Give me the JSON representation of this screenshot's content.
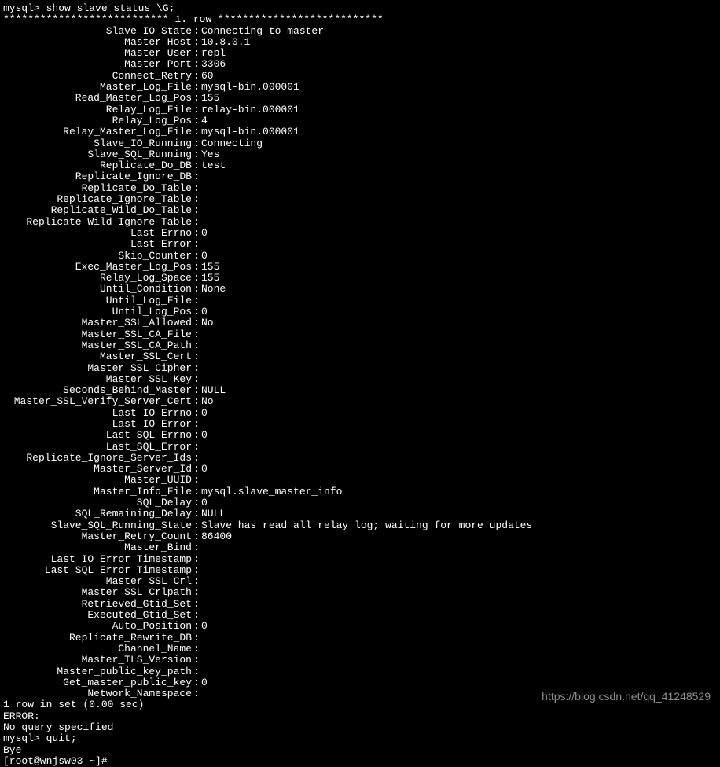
{
  "prompt1": "mysql> show slave status \\G;",
  "row_header": "*************************** 1. row ***************************",
  "status": [
    {
      "k": "Slave_IO_State",
      "v": "Connecting to master"
    },
    {
      "k": "Master_Host",
      "v": "10.8.0.1"
    },
    {
      "k": "Master_User",
      "v": "repl"
    },
    {
      "k": "Master_Port",
      "v": "3306"
    },
    {
      "k": "Connect_Retry",
      "v": "60"
    },
    {
      "k": "Master_Log_File",
      "v": "mysql-bin.000001"
    },
    {
      "k": "Read_Master_Log_Pos",
      "v": "155"
    },
    {
      "k": "Relay_Log_File",
      "v": "relay-bin.000001"
    },
    {
      "k": "Relay_Log_Pos",
      "v": "4"
    },
    {
      "k": "Relay_Master_Log_File",
      "v": "mysql-bin.000001"
    },
    {
      "k": "Slave_IO_Running",
      "v": "Connecting"
    },
    {
      "k": "Slave_SQL_Running",
      "v": "Yes"
    },
    {
      "k": "Replicate_Do_DB",
      "v": "test"
    },
    {
      "k": "Replicate_Ignore_DB",
      "v": ""
    },
    {
      "k": "Replicate_Do_Table",
      "v": ""
    },
    {
      "k": "Replicate_Ignore_Table",
      "v": ""
    },
    {
      "k": "Replicate_Wild_Do_Table",
      "v": ""
    },
    {
      "k": "Replicate_Wild_Ignore_Table",
      "v": ""
    },
    {
      "k": "Last_Errno",
      "v": "0"
    },
    {
      "k": "Last_Error",
      "v": ""
    },
    {
      "k": "Skip_Counter",
      "v": "0"
    },
    {
      "k": "Exec_Master_Log_Pos",
      "v": "155"
    },
    {
      "k": "Relay_Log_Space",
      "v": "155"
    },
    {
      "k": "Until_Condition",
      "v": "None"
    },
    {
      "k": "Until_Log_File",
      "v": ""
    },
    {
      "k": "Until_Log_Pos",
      "v": "0"
    },
    {
      "k": "Master_SSL_Allowed",
      "v": "No"
    },
    {
      "k": "Master_SSL_CA_File",
      "v": ""
    },
    {
      "k": "Master_SSL_CA_Path",
      "v": ""
    },
    {
      "k": "Master_SSL_Cert",
      "v": ""
    },
    {
      "k": "Master_SSL_Cipher",
      "v": ""
    },
    {
      "k": "Master_SSL_Key",
      "v": ""
    },
    {
      "k": "Seconds_Behind_Master",
      "v": "NULL"
    },
    {
      "k": "Master_SSL_Verify_Server_Cert",
      "v": "No"
    },
    {
      "k": "Last_IO_Errno",
      "v": "0"
    },
    {
      "k": "Last_IO_Error",
      "v": ""
    },
    {
      "k": "Last_SQL_Errno",
      "v": "0"
    },
    {
      "k": "Last_SQL_Error",
      "v": ""
    },
    {
      "k": "Replicate_Ignore_Server_Ids",
      "v": ""
    },
    {
      "k": "Master_Server_Id",
      "v": "0"
    },
    {
      "k": "Master_UUID",
      "v": ""
    },
    {
      "k": "Master_Info_File",
      "v": "mysql.slave_master_info"
    },
    {
      "k": "SQL_Delay",
      "v": "0"
    },
    {
      "k": "SQL_Remaining_Delay",
      "v": "NULL"
    },
    {
      "k": "Slave_SQL_Running_State",
      "v": "Slave has read all relay log; waiting for more updates"
    },
    {
      "k": "Master_Retry_Count",
      "v": "86400"
    },
    {
      "k": "Master_Bind",
      "v": ""
    },
    {
      "k": "Last_IO_Error_Timestamp",
      "v": ""
    },
    {
      "k": "Last_SQL_Error_Timestamp",
      "v": ""
    },
    {
      "k": "Master_SSL_Crl",
      "v": ""
    },
    {
      "k": "Master_SSL_Crlpath",
      "v": ""
    },
    {
      "k": "Retrieved_Gtid_Set",
      "v": ""
    },
    {
      "k": "Executed_Gtid_Set",
      "v": ""
    },
    {
      "k": "Auto_Position",
      "v": "0"
    },
    {
      "k": "Replicate_Rewrite_DB",
      "v": ""
    },
    {
      "k": "Channel_Name",
      "v": ""
    },
    {
      "k": "Master_TLS_Version",
      "v": ""
    },
    {
      "k": "Master_public_key_path",
      "v": ""
    },
    {
      "k": "Get_master_public_key",
      "v": "0"
    },
    {
      "k": "Network_Namespace",
      "v": ""
    }
  ],
  "footer1": "1 row in set (0.00 sec)",
  "footer_blank": "",
  "footer2": "ERROR:",
  "footer3": "No query specified",
  "prompt2": "mysql> quit;",
  "bye": "Bye",
  "last_line": "[root@wnjsw03 ~]#",
  "watermark": "https://blog.csdn.net/qq_41248529"
}
